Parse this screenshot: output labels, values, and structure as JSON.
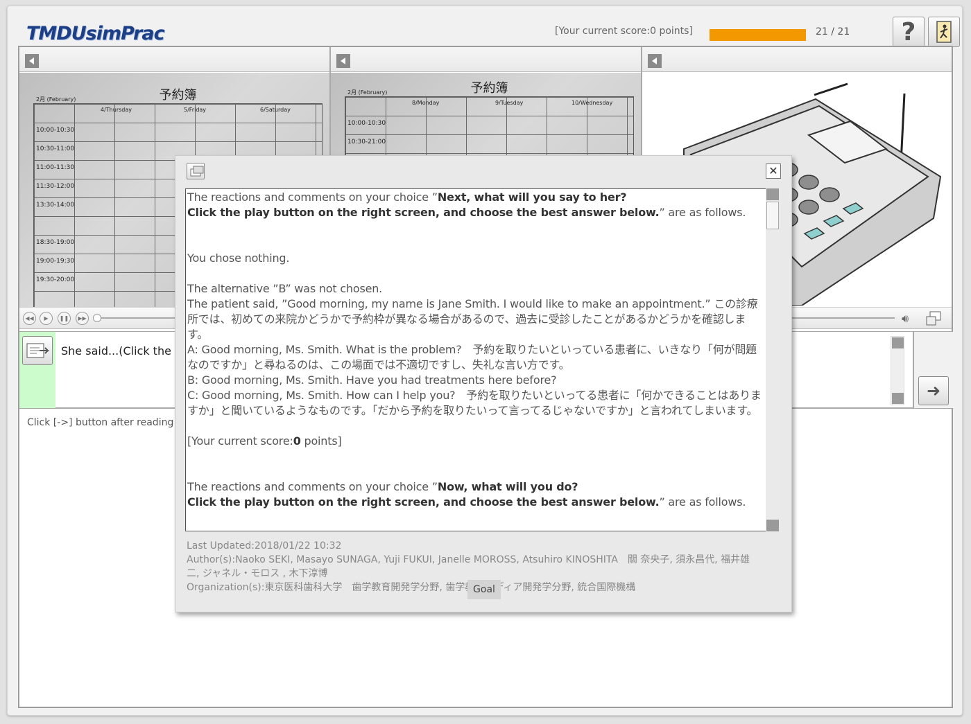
{
  "app": {
    "logo": "TMDUsimPrac",
    "score_text": "[Your current score:0 points]",
    "progress_pct": 100,
    "pages": "21 / 21",
    "help_label": "?"
  },
  "panels": {
    "left": {
      "ledger_title": "予約簿",
      "month": "2月 (February)",
      "days": [
        "4/Thursday",
        "5/Friday",
        "6/Saturday"
      ],
      "times": [
        "10:00-10:30",
        "10:30-11:00",
        "11:00-11:30",
        "11:30-12:00",
        "13:30-14:00",
        "",
        "18:30-19:00",
        "19:00-19:30",
        "19:30-20:00"
      ]
    },
    "middle": {
      "ledger_title": "予約簿",
      "month": "2月 (February)",
      "days": [
        "8/Monday",
        "9/Tuesday",
        "10/Wednesday"
      ],
      "times": [
        "10:00-10:30",
        "10:30-21:00"
      ]
    }
  },
  "question": {
    "text": "She said...(Click the"
  },
  "instruction": "Click [->] button after reading",
  "dialog": {
    "intro1_pre": "The reactions and comments on your choice ”",
    "intro1_bold1": "Next, what will you say to her?",
    "intro1_bold2": "Click the play button on the right screen, and choose the best answer below.",
    "intro1_post": "” are as follows.",
    "chose": "You chose nothing.",
    "not_chosen": "The alternative ”B” was not chosen.",
    "patient_said": "The patient said, ”Good morning, my name is Jane Smith. I would like to make an appointment.” この診療所では、初めての来院かどうかで予約枠が異なる場合があるので、過去に受診したことがあるかどうかを確認します。",
    "option_a": "A: Good morning, Ms. Smith. What is the problem?　予約を取りたいといっている患者に、いきなり「何が問題なのですか」と尋ねるのは、この場面では不適切ですし、失礼な言い方です。",
    "option_b": "B: Good morning, Ms. Smith. Have you had treatments here before?",
    "option_c": "C: Good morning, Ms. Smith. How can I help you?　予約を取りたいといってる患者に「何かできることはありますか」と聞いているようなものです。「だから予約を取りたいって言ってるじゃないですか」と言われてしまいます。",
    "score_pre": "[Your current score:",
    "score_value": "0",
    "score_post": " points]",
    "intro2_pre": "The reactions and comments on your choice ”",
    "intro2_bold1": "Now, what will you do?",
    "intro2_bold2": "Click the play button on the right screen, and choose the best answer below.",
    "intro2_post": "” are as follows.",
    "last_updated": "Last Updated:2018/01/22 10:32",
    "authors": "Author(s):Naoko SEKI, Masayo SUNAGA, Yuji FUKUI, Janelle MOROSS, Atsuhiro KINOSHITA　關 奈央子, 須永昌代, 福井雄二, ジャネル・モロス , 木下淳博",
    "organization": "Organization(s):東京医科歯科大学　歯学教育開発学分野, 歯学教育メディア開発学分野, 統合国際機構",
    "goal_label": "Goal",
    "close_label": "✕"
  }
}
